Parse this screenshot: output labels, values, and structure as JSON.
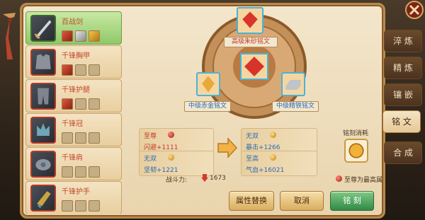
{
  "items": [
    {
      "name": "百战剑",
      "selected": true,
      "slots": [
        "red",
        "grey",
        "gold"
      ]
    },
    {
      "name": "千锋胸甲",
      "selected": false,
      "slots": [
        "red",
        "empty",
        "empty"
      ]
    },
    {
      "name": "千锋护腿",
      "selected": false,
      "slots": [
        "red",
        "empty",
        "empty"
      ]
    },
    {
      "name": "千锋冠",
      "selected": false,
      "slots": [
        "empty",
        "empty",
        "empty"
      ]
    },
    {
      "name": "千锋肩",
      "selected": false,
      "slots": [
        "empty",
        "empty",
        "empty"
      ]
    },
    {
      "name": "千锋护手",
      "selected": false,
      "slots": [
        "empty",
        "empty",
        "empty"
      ]
    }
  ],
  "medallion": {
    "top_label": "高级朱砂铭文",
    "left_label": "中级赤金铭文",
    "right_label": "中级精铁铭文"
  },
  "stats": {
    "before": [
      {
        "quality": "至尊",
        "orb": "red",
        "value": "闪避+1111",
        "value_color": "red"
      },
      {
        "quality": "无双",
        "orb": "gold",
        "value": "坚韧+1221",
        "value_color": "blue"
      }
    ],
    "after": [
      {
        "quality": "无双",
        "orb": "gold",
        "value": "暴击+1266",
        "value_color": "blue"
      },
      {
        "quality": "至高",
        "orb": "gold",
        "value": "气血+16021",
        "value_color": "blue"
      }
    ]
  },
  "power": {
    "label": "战斗力:",
    "value": "1673"
  },
  "cost_label": "铭刻消耗",
  "note": "至尊为最高属",
  "buttons": {
    "replace": "属性替换",
    "cancel": "取消",
    "engrave": "铭 刻"
  },
  "tabs": [
    {
      "label": "淬 炼",
      "active": false
    },
    {
      "label": "精 炼",
      "active": false
    },
    {
      "label": "镶 嵌",
      "active": false
    },
    {
      "label": "铭 文",
      "active": true
    },
    {
      "label": "合 成",
      "active": false
    }
  ],
  "colors": {
    "accent_green": "#2f8a45",
    "frame": "#b88a4a",
    "quality_red": "#c0392b",
    "value_blue": "#2d6ab5"
  }
}
